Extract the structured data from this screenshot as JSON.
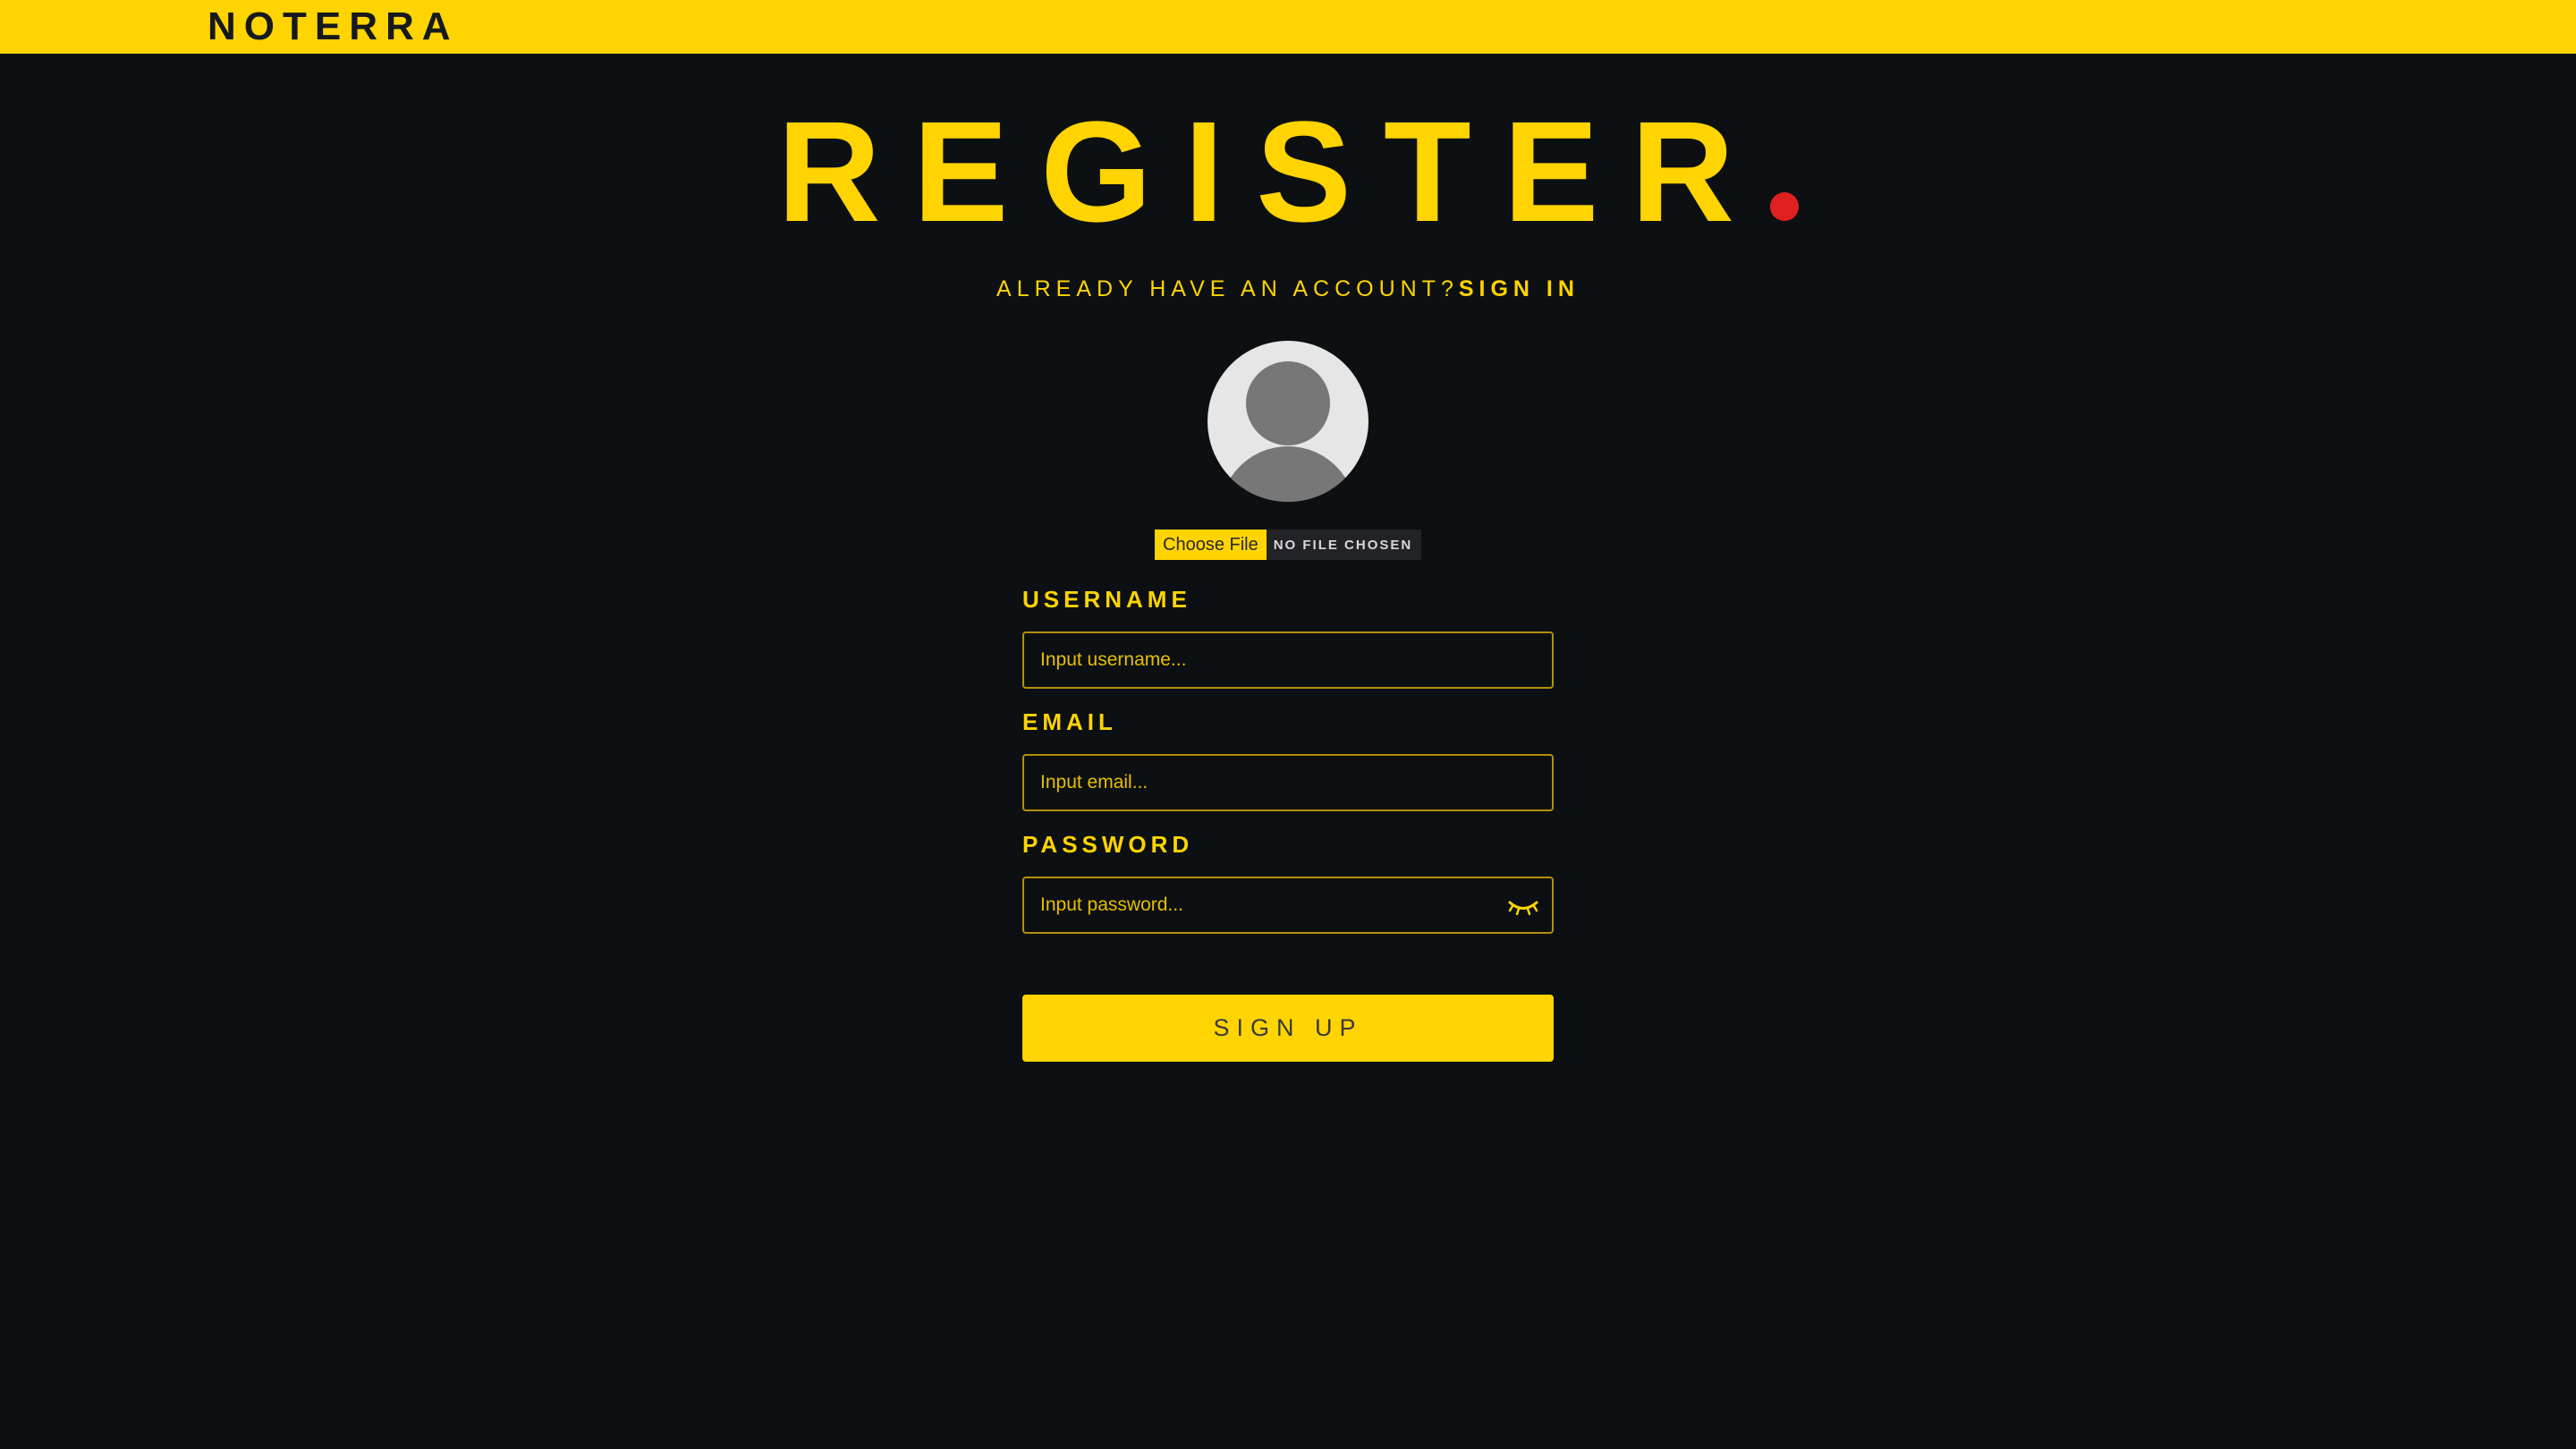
{
  "header": {
    "brand": "NOTERRA"
  },
  "page": {
    "title": "REGISTER",
    "signin_prompt": "ALREADY HAVE AN ACCOUNT?",
    "signin_link": "SIGN IN"
  },
  "file_input": {
    "button_label": "Choose File",
    "status": "NO FILE CHOSEN"
  },
  "form": {
    "username": {
      "label": "USERNAME",
      "placeholder": "Input username...",
      "value": ""
    },
    "email": {
      "label": "EMAIL",
      "placeholder": "Input email...",
      "value": ""
    },
    "password": {
      "label": "PASSWORD",
      "placeholder": "Input password...",
      "value": "",
      "toggle_icon": "eye-closed-icon"
    },
    "submit_label": "SIGN UP"
  },
  "colors": {
    "accent": "#ffd400",
    "background": "#0d1013",
    "dot": "#e02020",
    "avatar_bg": "#e6e6e6",
    "avatar_fg": "#777777"
  }
}
